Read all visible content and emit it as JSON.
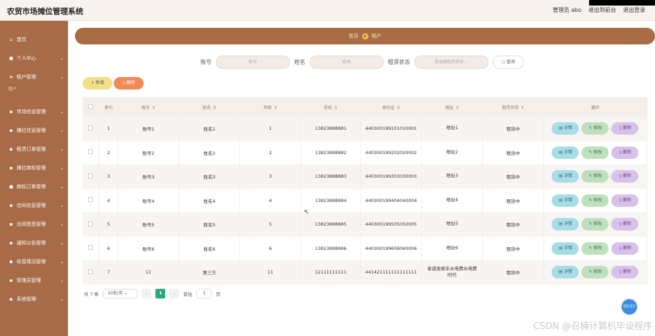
{
  "app": {
    "title": "农贸市场摊位管理系统"
  },
  "top_actions": [
    "管理员 abo",
    "退出到前台",
    "退出登录"
  ],
  "sidebar": {
    "items": [
      {
        "icon": "home-icon",
        "glyph": "⌂",
        "label": "首页",
        "chev": ""
      },
      {
        "icon": "user-icon",
        "glyph": "●",
        "label": "个人中心",
        "chev": "⌄"
      },
      {
        "icon": "send-icon",
        "glyph": "➤",
        "label": "租户管理",
        "chev": "⌄"
      },
      {
        "icon": "grid-icon",
        "glyph": "▪",
        "label": "市场信息管理",
        "chev": "⌄"
      },
      {
        "icon": "grid-icon",
        "glyph": "▪",
        "label": "摊位信息管理",
        "chev": "⌄"
      },
      {
        "icon": "grid-icon",
        "glyph": "▪",
        "label": "租赁订单管理",
        "chev": "⌄"
      },
      {
        "icon": "grid-icon",
        "glyph": "▪",
        "label": "摊位商标管理",
        "chev": "⌄"
      },
      {
        "icon": "user-icon",
        "glyph": "●",
        "label": "商标订单管理",
        "chev": "⌄"
      },
      {
        "icon": "grid-icon",
        "glyph": "▪",
        "label": "合同信息管理",
        "chev": "⌄"
      },
      {
        "icon": "grid-icon",
        "glyph": "▪",
        "label": "合同签签管理",
        "chev": "⌄"
      },
      {
        "icon": "grid-icon",
        "glyph": "▪",
        "label": "通知公告管理",
        "chev": "⌄"
      },
      {
        "icon": "pin-icon",
        "glyph": "◆",
        "label": "经营情况管理",
        "chev": "⌄"
      },
      {
        "icon": "grid-icon",
        "glyph": "▪",
        "label": "管理员管理",
        "chev": "⌄"
      },
      {
        "icon": "grid-icon",
        "glyph": "▪",
        "label": "系统管理",
        "chev": "⌄"
      }
    ],
    "sub_label": "租户"
  },
  "breadcrumb": {
    "home": "首页",
    "current": "租户"
  },
  "search": {
    "account_label": "账号",
    "account_placeholder": "账号",
    "name_label": "姓名",
    "name_placeholder": "姓名",
    "status_label": "租赁状态",
    "status_placeholder": "请选择租赁状态",
    "query_button": "查询"
  },
  "toolbar": {
    "add": "新增",
    "delete": "删除"
  },
  "table": {
    "headers": [
      "索引",
      "账号",
      "姓名",
      "年龄",
      "手机",
      "身份证",
      "地址",
      "租赁状态",
      "操作"
    ],
    "sort_mark": "⇕",
    "rows": [
      [
        "1",
        "账号1",
        "姓名1",
        "1",
        "13823888881",
        "440300199101010001",
        "地址1",
        "租赁中"
      ],
      [
        "2",
        "账号2",
        "姓名2",
        "2",
        "13823888882",
        "440300199202020002",
        "地址2",
        "租赁中"
      ],
      [
        "3",
        "账号3",
        "姓名3",
        "3",
        "13823888883",
        "440300199303030003",
        "地址3",
        "租赁中"
      ],
      [
        "4",
        "账号4",
        "姓名4",
        "4",
        "13823888884",
        "440300199404040004",
        "地址4",
        "租赁中"
      ],
      [
        "5",
        "账号5",
        "姓名5",
        "5",
        "13823888885",
        "440300199505050005",
        "地址5",
        "租赁中"
      ],
      [
        "6",
        "账号6",
        "姓名6",
        "6",
        "13823888886",
        "440300199606060006",
        "地址6",
        "租赁中"
      ],
      [
        "7",
        "11",
        "第三方",
        "11",
        "12111111111",
        "441421111111111111",
        "省道发顺丰水电费水电费时代",
        "租赁中"
      ]
    ],
    "ops": {
      "detail": "详情",
      "edit": "修改",
      "delete": "删除"
    }
  },
  "pager": {
    "total": "共 7 条",
    "size": "10条/页",
    "page": "1",
    "goto_label": "前往",
    "goto_value": "1",
    "page_suffix": "页"
  },
  "float_badge": "00:51",
  "watermark": "CSDN @召楠计算机毕设程序",
  "colors": {
    "sidebar": "#a76b47",
    "crumb": "#a86d45",
    "add": "#f2df86",
    "delete": "#f28a55",
    "active_page": "#2aa87a"
  }
}
